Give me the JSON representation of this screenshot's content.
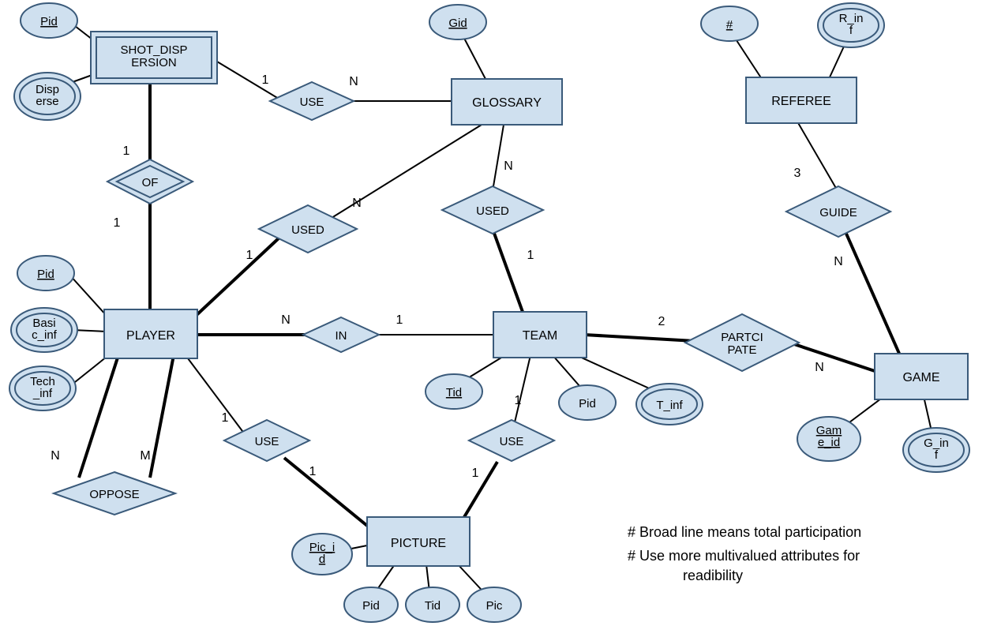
{
  "entities": {
    "shot_dispersion": "SHOT_DISPERSION",
    "glossary": "GLOSSARY",
    "referee": "REFEREE",
    "player": "PLAYER",
    "team": "TEAM",
    "game": "GAME",
    "picture": "PICTURE"
  },
  "relationships": {
    "use1": "USE",
    "of": "OF",
    "used1": "USED",
    "used2": "USED",
    "guide": "GUIDE",
    "in": "IN",
    "participate": "PARTCIPATE",
    "oppose": "OPPOSE",
    "use2": "USE",
    "use3": "USE"
  },
  "attributes": {
    "sd_pid": "Pid",
    "sd_disperse": "Disperse",
    "gl_gid": "Gid",
    "ref_hash": "#",
    "ref_rinf": "R_inf",
    "pl_pid": "Pid",
    "pl_basic": "Basic_inf",
    "pl_tech": "Tech_inf",
    "tm_tid": "Tid",
    "tm_pid": "Pid",
    "tm_tinf": "T_inf",
    "gm_gameid": "Game_id",
    "gm_ginf": "G_inf",
    "pic_picid": "Pic_id",
    "pic_pid": "Pid",
    "pic_tid": "Tid",
    "pic_pic": "Pic"
  },
  "cardinalities": {
    "sd_use_1": "1",
    "use_gl_n": "N",
    "sd_of_1": "1",
    "of_pl_1": "1",
    "pl_used_1": "1",
    "used_gl_n": "N",
    "gl_used_n": "N",
    "used_tm_1": "1",
    "ref_guide_3": "3",
    "guide_gm_n": "N",
    "pl_in_n": "N",
    "in_tm_1": "1",
    "tm_part_2": "2",
    "part_gm_n": "N",
    "pl_opp_n": "N",
    "pl_opp_m": "M",
    "pl_use2_1": "1",
    "use2_pic_1": "1",
    "tm_use3_1": "1",
    "use3_pic_1": "1"
  },
  "notes": {
    "line1": "# Broad line means  total participation",
    "line2": "# Use more multivalued attributes for",
    "line3": "readibility"
  }
}
